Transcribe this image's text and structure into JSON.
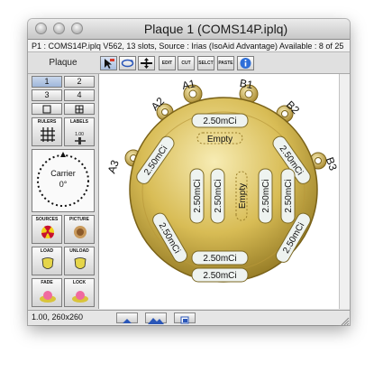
{
  "window": {
    "title": "Plaque 1 (COMS14P.iplq)",
    "info": "P1 : COMS14P.iplq V562, 13 slots, Source : Irias (IsoAid Advantage) Available : 8 of 25"
  },
  "toolbar": {
    "plaque_label": "Plaque",
    "edit_label": "EDIT",
    "cut_label": "CUT",
    "select_label": "SELCT",
    "paste_label": "PASTE"
  },
  "sidebar": {
    "btn_1": "1",
    "btn_2": "2",
    "btn_3": "3",
    "btn_4": "4",
    "rulers_label": "RULERS",
    "labels_label": "LABELS",
    "labels_value": "1.00",
    "carrier_label": "Carrier",
    "carrier_angle": "0°",
    "sources_label": "SOURCES",
    "picture_label": "PICTURE",
    "load_label": "LOAD",
    "unload_label": "UNLOAD",
    "fade_label": "FADE",
    "lock_label": "LOCK"
  },
  "plaque": {
    "eyelets": [
      "A1",
      "B1",
      "A2",
      "B2",
      "A3",
      "B3"
    ],
    "slots": {
      "top": "2.50mCi",
      "top_empty": "Empty",
      "left_upper": "2.50mCi",
      "right_upper": "2.50mCi",
      "col_1": "2.50mCi",
      "col_2": "2.50mCi",
      "col_center": "Empty",
      "col_4": "2.50mCi",
      "col_5": "2.50mCi",
      "left_lower": "2.50mCi",
      "right_lower": "2.50mCi",
      "bottom_1": "2.50mCi",
      "bottom_2": "2.50mCi"
    }
  },
  "status": {
    "zoom": "1.00, 260x260"
  },
  "colors": {
    "gold_light": "#f3e7a8",
    "gold_mid": "#d9bd55",
    "gold_dark": "#8e7420",
    "seed_fill": "#eef3f0",
    "accent_blue": "#2f6fd8"
  }
}
